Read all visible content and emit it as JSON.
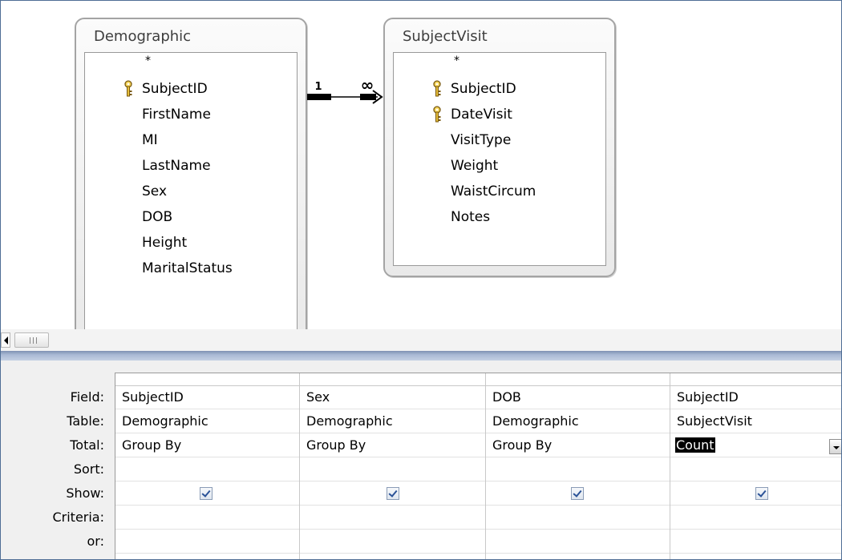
{
  "diagram": {
    "tables": [
      {
        "title": "Demographic",
        "star": "*",
        "fields": [
          {
            "name": "SubjectID",
            "key": true
          },
          {
            "name": "FirstName",
            "key": false
          },
          {
            "name": "MI",
            "key": false
          },
          {
            "name": "LastName",
            "key": false
          },
          {
            "name": "Sex",
            "key": false
          },
          {
            "name": "DOB",
            "key": false
          },
          {
            "name": "Height",
            "key": false
          },
          {
            "name": "MaritalStatus",
            "key": false
          }
        ]
      },
      {
        "title": "SubjectVisit",
        "star": "*",
        "fields": [
          {
            "name": "SubjectID",
            "key": true
          },
          {
            "name": "DateVisit",
            "key": true
          },
          {
            "name": "VisitType",
            "key": false
          },
          {
            "name": "Weight",
            "key": false
          },
          {
            "name": "WaistCircum",
            "key": false
          },
          {
            "name": "Notes",
            "key": false
          }
        ]
      }
    ],
    "relationship": {
      "one_label": "1",
      "many_label": "∞"
    }
  },
  "grid": {
    "row_labels": [
      "Field:",
      "Table:",
      "Total:",
      "Sort:",
      "Show:",
      "Criteria:",
      "or:"
    ],
    "columns": [
      {
        "field": "SubjectID",
        "table": "Demographic",
        "total": "Group By",
        "sort": "",
        "show": true,
        "criteria": "",
        "or": "",
        "selected": false
      },
      {
        "field": "Sex",
        "table": "Demographic",
        "total": "Group By",
        "sort": "",
        "show": true,
        "criteria": "",
        "or": "",
        "selected": false
      },
      {
        "field": "DOB",
        "table": "Demographic",
        "total": "Group By",
        "sort": "",
        "show": true,
        "criteria": "",
        "or": "",
        "selected": false
      },
      {
        "field": "SubjectID",
        "table": "SubjectVisit",
        "total": "Count",
        "sort": "",
        "show": true,
        "criteria": "",
        "or": "",
        "selected": true
      }
    ]
  },
  "colors": {
    "splitter": "#a9b9d4",
    "frame_border": "#4f6e95",
    "checkmark": "#2a5297"
  }
}
